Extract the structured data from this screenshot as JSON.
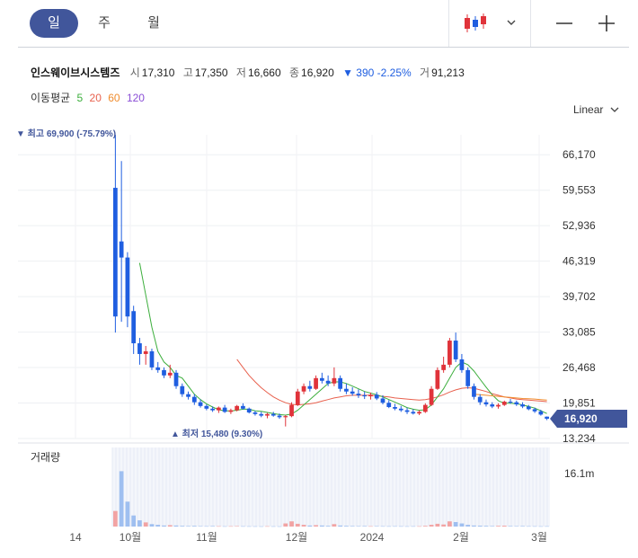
{
  "tabs": [
    {
      "label": "일",
      "active": true
    },
    {
      "label": "주",
      "active": false
    },
    {
      "label": "월",
      "active": false
    }
  ],
  "toolbar": {
    "chart_type_icon": "candlestick-icon",
    "zoom_out": "minus-icon",
    "zoom_in": "plus-icon"
  },
  "quote": {
    "name": "인스웨이브시스템즈",
    "open_label": "시",
    "open": "17,310",
    "high_label": "고",
    "high": "17,350",
    "low_label": "저",
    "low": "16,660",
    "close_label": "종",
    "close": "16,920",
    "change": "▼ 390 -2.25%",
    "volume_label": "거",
    "volume": "91,213"
  },
  "moving_average": {
    "label": "이동평균",
    "periods": [
      {
        "value": "5",
        "color": "#3cae3c"
      },
      {
        "value": "20",
        "color": "#e8614e"
      },
      {
        "value": "60",
        "color": "#f08c2e"
      },
      {
        "value": "120",
        "color": "#8a4ed6"
      }
    ]
  },
  "scale_mode": "Linear",
  "colors": {
    "up": "#e0333a",
    "down": "#1f5ee0",
    "ma5": "#3cae3c",
    "ma20": "#e8614e",
    "ma60": "#f08c2e",
    "accent": "#41569b",
    "vol_up": "#f2a3a3",
    "vol_down": "#9fbff0"
  },
  "chart_data": {
    "type": "candlestick",
    "y_ticks": [
      66170,
      59553,
      52936,
      46319,
      39702,
      33085,
      26468,
      19851,
      13234
    ],
    "y_tick_labels": [
      "66,170",
      "59,553",
      "52,936",
      "46,319",
      "39,702",
      "33,085",
      "26,468",
      "19,851",
      "13,234"
    ],
    "ylim": [
      13234,
      69900
    ],
    "x_labels": [
      "14",
      "10월",
      "11월",
      "12월",
      "2024",
      "2월",
      "3월"
    ],
    "current_price_label": "16,920",
    "current_price": 16920,
    "max_label": "▼ 최고 69,900 (-75.79%)",
    "max_value": 69900,
    "min_label": "▲ 최저 15,480 (9.30%)",
    "min_value": 15480,
    "volume_label": "거래량",
    "volume_tick_label": "16.1m",
    "volume_max": 16100000,
    "candles": [
      [
        60000,
        69900,
        33000,
        36000
      ],
      [
        50000,
        65000,
        35000,
        47000
      ],
      [
        47000,
        48000,
        34000,
        36000
      ],
      [
        37000,
        38000,
        29000,
        31000
      ],
      [
        31000,
        32000,
        27000,
        29000
      ],
      [
        29000,
        30500,
        27000,
        29500
      ],
      [
        29500,
        30000,
        26000,
        26500
      ],
      [
        26500,
        27500,
        25500,
        26000
      ],
      [
        26000,
        26500,
        24500,
        25000
      ],
      [
        25000,
        27000,
        24500,
        25500
      ],
      [
        25500,
        26000,
        22500,
        23000
      ],
      [
        23000,
        23500,
        21000,
        21500
      ],
      [
        21500,
        22000,
        20500,
        21000
      ],
      [
        21000,
        21500,
        19500,
        20000
      ],
      [
        20000,
        20500,
        19000,
        19300
      ],
      [
        19300,
        19600,
        18500,
        18800
      ],
      [
        18800,
        19200,
        18200,
        18500
      ],
      [
        18500,
        19200,
        18000,
        19000
      ],
      [
        19000,
        19500,
        18000,
        18200
      ],
      [
        18200,
        18800,
        17800,
        18500
      ],
      [
        18500,
        19500,
        18300,
        19300
      ],
      [
        19300,
        19800,
        18600,
        18800
      ],
      [
        18800,
        19000,
        17900,
        18100
      ],
      [
        18100,
        18400,
        17500,
        17800
      ],
      [
        17800,
        18200,
        17200,
        17500
      ],
      [
        17500,
        18000,
        17000,
        17800
      ],
      [
        17800,
        18200,
        17300,
        17500
      ],
      [
        17500,
        17900,
        16900,
        17200
      ],
      [
        17200,
        17600,
        15480,
        17400
      ],
      [
        17400,
        20000,
        17200,
        19500
      ],
      [
        19500,
        22500,
        19300,
        22000
      ],
      [
        22000,
        23500,
        21500,
        23000
      ],
      [
        23000,
        24000,
        22000,
        22500
      ],
      [
        22500,
        25000,
        22300,
        24500
      ],
      [
        24500,
        25500,
        23500,
        24000
      ],
      [
        24000,
        25000,
        23000,
        23500
      ],
      [
        23500,
        26500,
        23000,
        24500
      ],
      [
        24500,
        25000,
        22000,
        22500
      ],
      [
        22500,
        23500,
        21500,
        22000
      ],
      [
        22000,
        22800,
        21200,
        21600
      ],
      [
        21600,
        22400,
        20800,
        21300
      ],
      [
        21300,
        22000,
        20600,
        21100
      ],
      [
        21100,
        21800,
        20500,
        21400
      ],
      [
        21400,
        21900,
        20400,
        20700
      ],
      [
        20700,
        21300,
        19600,
        19900
      ],
      [
        19900,
        20400,
        18900,
        19100
      ],
      [
        19100,
        19700,
        18500,
        18800
      ],
      [
        18800,
        19300,
        18200,
        18500
      ],
      [
        18500,
        19000,
        17800,
        18200
      ],
      [
        18200,
        18700,
        17700,
        17900
      ],
      [
        17900,
        18500,
        17600,
        18200
      ],
      [
        18200,
        19800,
        18000,
        19500
      ],
      [
        19500,
        23000,
        19300,
        22500
      ],
      [
        22500,
        26500,
        22300,
        26000
      ],
      [
        26000,
        28500,
        25500,
        27000
      ],
      [
        27000,
        32000,
        26500,
        31500
      ],
      [
        31500,
        33000,
        27500,
        28000
      ],
      [
        28000,
        29000,
        25500,
        26000
      ],
      [
        26000,
        26500,
        22500,
        23000
      ],
      [
        23000,
        23500,
        20500,
        21000
      ],
      [
        21000,
        21500,
        19500,
        20000
      ],
      [
        20000,
        20500,
        19200,
        19600
      ],
      [
        19600,
        20000,
        18900,
        19200
      ],
      [
        19200,
        19800,
        18800,
        19500
      ],
      [
        19500,
        20300,
        19300,
        20100
      ],
      [
        20100,
        20600,
        19700,
        20000
      ],
      [
        20000,
        20300,
        19300,
        19600
      ],
      [
        19600,
        20000,
        18900,
        19200
      ],
      [
        19200,
        19500,
        18500,
        18700
      ],
      [
        18700,
        19000,
        18000,
        18300
      ],
      [
        18300,
        18600,
        17500,
        17700
      ],
      [
        17310,
        17350,
        16660,
        16920
      ]
    ],
    "ma5": [
      null,
      null,
      null,
      null,
      46000,
      40000,
      34000,
      29500,
      27500,
      26500,
      25000,
      24500,
      23000,
      21500,
      20500,
      19700,
      19100,
      18600,
      18400,
      18400,
      18500,
      18700,
      18700,
      18400,
      18300,
      18100,
      17900,
      17700,
      17600,
      17800,
      18500,
      19500,
      20500,
      21500,
      22500,
      23500,
      23800,
      23800,
      23500,
      23000,
      22500,
      22000,
      21700,
      21400,
      21000,
      20500,
      20000,
      19500,
      19000,
      18700,
      18500,
      18600,
      19500,
      21000,
      22500,
      24500,
      26500,
      27500,
      27000,
      25800,
      24300,
      22800,
      21400,
      20300,
      19800,
      19800,
      19700,
      19500,
      19200,
      18900,
      18400,
      17900
    ],
    "ma20": [
      null,
      null,
      null,
      null,
      null,
      null,
      null,
      null,
      null,
      null,
      null,
      null,
      null,
      null,
      null,
      null,
      null,
      null,
      null,
      null,
      28000,
      26500,
      25000,
      23800,
      22700,
      21800,
      21000,
      20400,
      19900,
      19600,
      19500,
      19600,
      19700,
      19900,
      20200,
      20500,
      20800,
      21000,
      21200,
      21300,
      21300,
      21300,
      21300,
      21200,
      21100,
      21000,
      20800,
      20700,
      20600,
      20500,
      20400,
      20500,
      20700,
      21000,
      21400,
      21900,
      22300,
      22600,
      22700,
      22600,
      22300,
      22000,
      21600,
      21300,
      21000,
      20800,
      20600,
      20500,
      20400,
      20300,
      20200,
      20100
    ],
    "ma60": [
      null,
      null,
      null,
      null,
      null,
      null,
      null,
      null,
      null,
      null,
      null,
      null,
      null,
      null,
      null,
      null,
      null,
      null,
      null,
      null,
      null,
      null,
      null,
      null,
      null,
      null,
      null,
      null,
      null,
      null,
      null,
      null,
      null,
      null,
      null,
      null,
      null,
      null,
      null,
      null,
      null,
      null,
      null,
      null,
      null,
      null,
      null,
      null,
      null,
      null,
      null,
      null,
      null,
      null,
      null,
      null,
      null,
      null,
      null,
      21500,
      21400,
      21300,
      21200,
      21100,
      21000,
      20900,
      20800,
      20700,
      20650,
      20600,
      20500,
      20400
    ],
    "volumes": [
      4500000,
      16000000,
      7200000,
      3200000,
      1800000,
      1200000,
      700000,
      500000,
      300000,
      400000,
      300000,
      200000,
      150000,
      200000,
      120000,
      100000,
      150000,
      100000,
      80000,
      100000,
      120000,
      90000,
      80000,
      70000,
      60000,
      90000,
      70000,
      60000,
      900000,
      1500000,
      800000,
      500000,
      300000,
      400000,
      300000,
      200000,
      700000,
      300000,
      200000,
      150000,
      120000,
      150000,
      100000,
      120000,
      100000,
      90000,
      100000,
      90000,
      80000,
      90000,
      90000,
      200000,
      500000,
      800000,
      600000,
      1500000,
      1300000,
      900000,
      500000,
      300000,
      250000,
      200000,
      150000,
      200000,
      250000,
      150000,
      120000,
      150000,
      100000,
      90000,
      80000,
      91213
    ],
    "volume_colors_up": [
      true,
      false,
      false,
      false,
      false,
      true,
      false,
      false,
      false,
      true,
      false,
      false,
      false,
      false,
      false,
      false,
      false,
      true,
      false,
      true,
      true,
      false,
      false,
      false,
      false,
      true,
      false,
      false,
      true,
      true,
      true,
      true,
      false,
      true,
      false,
      false,
      true,
      false,
      false,
      false,
      false,
      false,
      true,
      false,
      false,
      false,
      false,
      false,
      false,
      false,
      true,
      true,
      true,
      true,
      true,
      true,
      false,
      false,
      false,
      false,
      false,
      false,
      false,
      true,
      true,
      false,
      false,
      false,
      false,
      false,
      false,
      false
    ]
  }
}
